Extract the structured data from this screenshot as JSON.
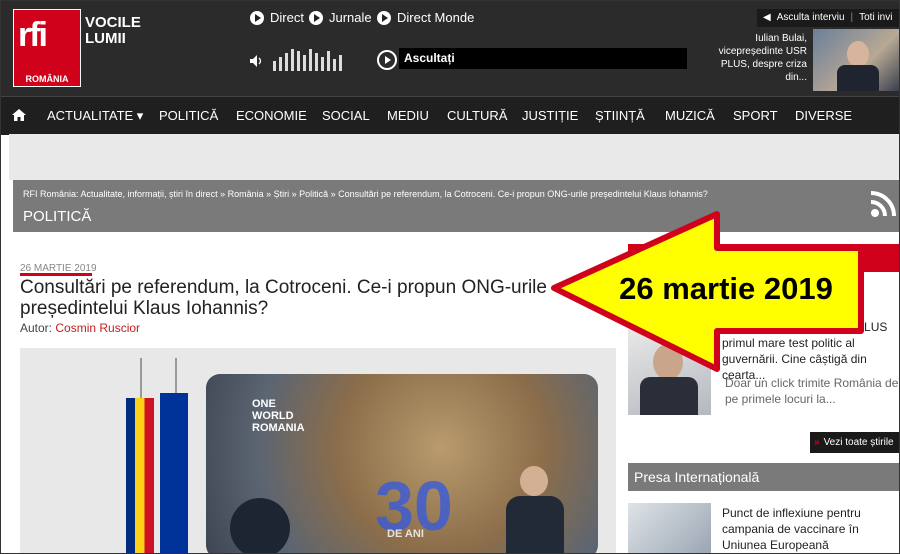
{
  "header": {
    "logo_text": "rfi",
    "logo_sub": "ROMÂNIA",
    "brand_line1": "VOCILE",
    "brand_line2": "LUMII",
    "radio_links": [
      "Direct",
      "Jurnale",
      "Direct Monde"
    ],
    "listen_label": "Ascultați",
    "interview_label": "Asculta interviu",
    "all_label": "Toti invi",
    "interview_text": "Iulian Bulai, vicepreședinte USR PLUS, despre criza din..."
  },
  "nav": {
    "items": [
      "ACTUALITATE ▾",
      "POLITICĂ",
      "ECONOMIE",
      "SOCIAL",
      "MEDIU",
      "CULTURĂ",
      "JUSTIȚIE",
      "ȘTIINȚĂ",
      "MUZICĂ",
      "SPORT",
      "DIVERSE"
    ]
  },
  "breadcrumb": {
    "text": "RFI România: Actualitate, informații, știri în direct » România » Știri » Politică » Consultări pe referendum, la Cotroceni. Ce-i propun ONG-urile președintelui Klaus Iohannis?",
    "section": "POLITICĂ"
  },
  "article": {
    "date": "26 MARTIE 2019",
    "title": "Consultări pe referendum, la Cotroceni. Ce-i propun ONG-urile președintelui Klaus Iohannis?",
    "author_label": "Autor:",
    "author_name": "Cosmin Ruscior",
    "photo_text_1": "ONE",
    "photo_text_2": "WORLD",
    "photo_text_3": "ROMANIA",
    "photo_thirty": "30",
    "photo_deani": "DE ANI"
  },
  "sidebar": {
    "story1": "Cum au picat liderii USR PLUS primul mare test politic al guvernării. Cine câștigă din cearta...",
    "story2": "Doar un click trimite România de pe primele locuri la...",
    "see_all": "Vezi toate știrile",
    "presa_header": "Presa Internațională",
    "presa_story": "Punct de inflexiune pentru campania de vaccinare în Uniunea Europeană"
  },
  "annotation": {
    "text": "26 martie 2019",
    "arrow_color": "#ffff00",
    "border_color": "#d0021b"
  }
}
